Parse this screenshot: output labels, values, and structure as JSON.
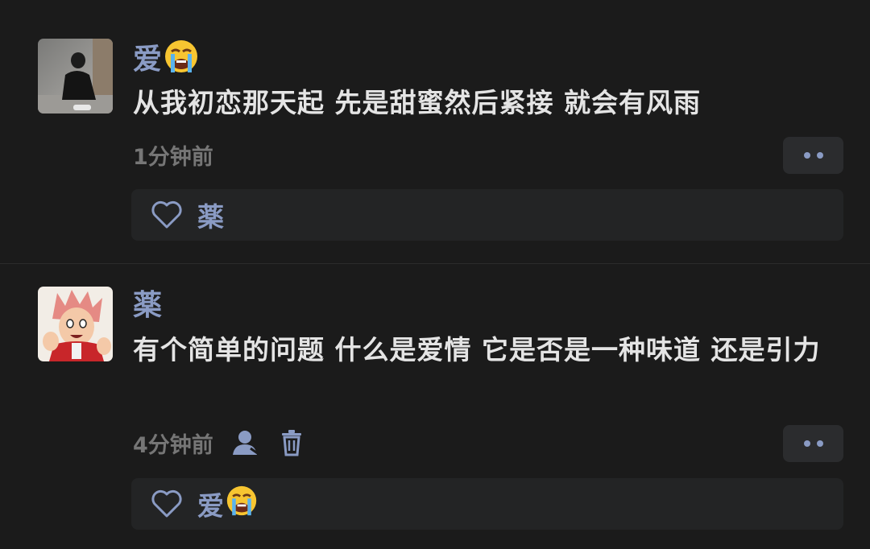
{
  "comments": [
    {
      "username": "爱",
      "username_emoji": "loudly-crying-face-emoji",
      "text": "从我初恋那天起 先是甜蜜然后紧接 就会有风雨",
      "time": "1分钟前",
      "liked_by": "薬",
      "liked_by_emoji": ""
    },
    {
      "username": "薬",
      "username_emoji": "",
      "text": "有个简单的问题 什么是爱情 它是否是一种味道 还是引力",
      "time": "4分钟前",
      "liked_by": "爱",
      "liked_by_emoji": "loudly-crying-face-emoji"
    }
  ],
  "colors": {
    "background": "#1b1b1b",
    "username": "#8a9bc4",
    "text": "#e4e4e4",
    "time": "#767676",
    "panel": "#232425",
    "button": "#2b2c2e"
  }
}
